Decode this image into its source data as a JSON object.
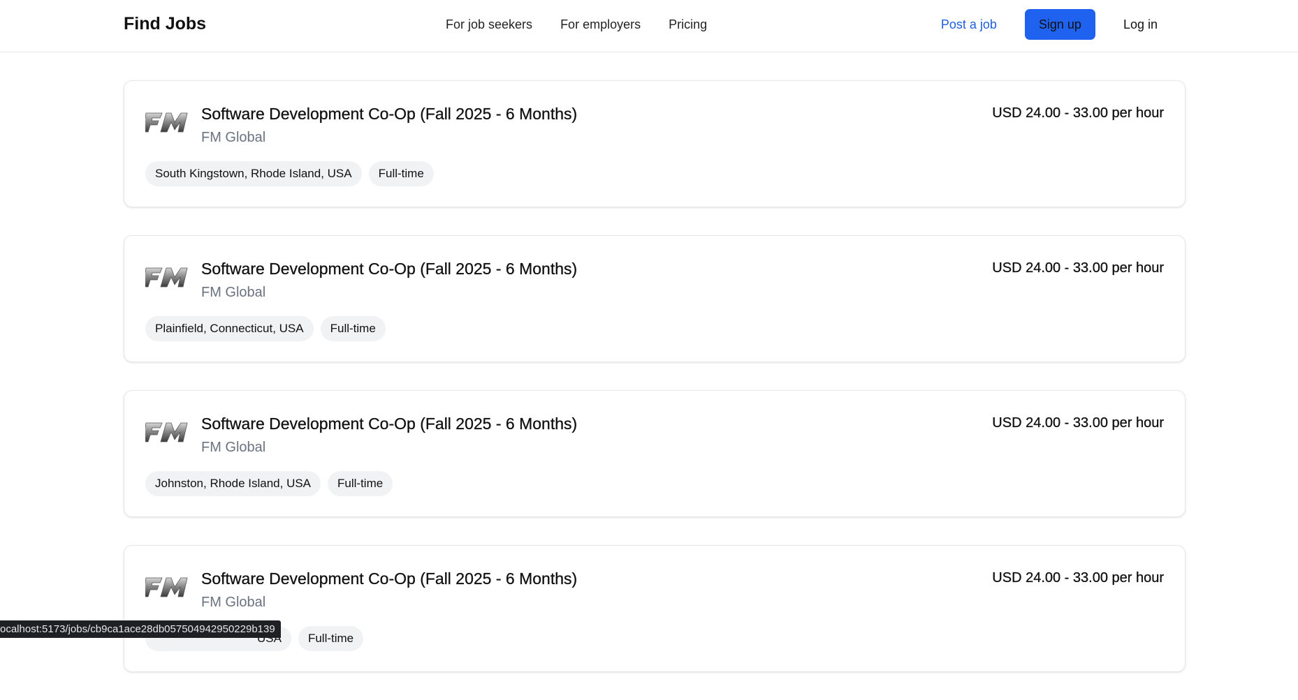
{
  "header": {
    "brand": "Find Jobs",
    "nav": [
      "For job seekers",
      "For employers",
      "Pricing"
    ],
    "post_job": "Post a job",
    "signup": "Sign up",
    "login": "Log in"
  },
  "jobs": [
    {
      "title": "Software Development Co-Op (Fall 2025 - 6 Months)",
      "company": "FM Global",
      "salary": "USD 24.00 - 33.00 per hour",
      "location": "South Kingstown, Rhode Island, USA",
      "type": "Full-time"
    },
    {
      "title": "Software Development Co-Op (Fall 2025 - 6 Months)",
      "company": "FM Global",
      "salary": "USD 24.00 - 33.00 per hour",
      "location": "Plainfield, Connecticut, USA",
      "type": "Full-time"
    },
    {
      "title": "Software Development Co-Op (Fall 2025 - 6 Months)",
      "company": "FM Global",
      "salary": "USD 24.00 - 33.00 per hour",
      "location": "Johnston, Rhode Island, USA",
      "type": "Full-time"
    },
    {
      "title": "Software Development Co-Op (Fall 2025 - 6 Months)",
      "company": "FM Global",
      "salary": "USD 24.00 - 33.00 per hour",
      "location": "USA",
      "type": "Full-time"
    }
  ],
  "status_bar": {
    "url": "ocalhost:5173/jobs/cb9ca1ace28db057504942950229b139"
  },
  "colors": {
    "accent": "#1e62ef",
    "link": "#1d5fe0",
    "tag_bg": "#f1f2f4",
    "muted_text": "#6b7280"
  },
  "icons": [
    "fm-global-logo-icon"
  ]
}
